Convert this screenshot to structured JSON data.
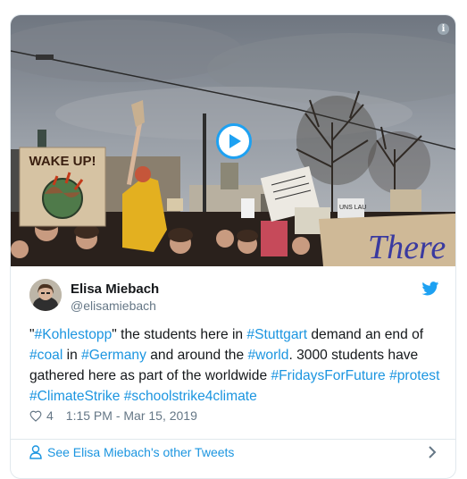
{
  "tweet": {
    "author_name": "Elisa Miebach",
    "author_handle": "@elisamiebach",
    "text_parts": [
      {
        "t": "\"",
        "tag": false
      },
      {
        "t": "#Kohlestopp",
        "tag": true
      },
      {
        "t": "\" the students here in ",
        "tag": false
      },
      {
        "t": "#Stuttgart",
        "tag": true
      },
      {
        "t": " demand an end of ",
        "tag": false
      },
      {
        "t": "#coal",
        "tag": true
      },
      {
        "t": " in ",
        "tag": false
      },
      {
        "t": "#Germany",
        "tag": true
      },
      {
        "t": " and around the ",
        "tag": false
      },
      {
        "t": "#world",
        "tag": true
      },
      {
        "t": ". 3000 students have gathered here as part of the worldwide ",
        "tag": false
      },
      {
        "t": "#FridaysForFuture",
        "tag": true
      },
      {
        "t": " ",
        "tag": false
      },
      {
        "t": "#protest",
        "tag": true
      },
      {
        "t": " ",
        "tag": false
      },
      {
        "t": "#ClimateStrike",
        "tag": true
      },
      {
        "t": " ",
        "tag": false
      },
      {
        "t": "#schoolstrike4climate",
        "tag": true
      }
    ],
    "likes": "4",
    "timestamp": "1:15 PM - Mar 15, 2019",
    "footer_link": "See Elisa Miebach's other Tweets"
  },
  "media": {
    "sign_left": "WAKE UP!",
    "sign_right": "There",
    "sign_small": "UNS LAU"
  },
  "icons": {
    "play": "play-icon",
    "info": "info-icon",
    "bird": "twitter-bird-icon",
    "heart": "heart-icon",
    "person": "person-icon",
    "chevron": "chevron-right-icon"
  },
  "colors": {
    "accent": "#1da1f2",
    "link": "#1b95e0",
    "text": "#14171a",
    "muted": "#657786"
  }
}
